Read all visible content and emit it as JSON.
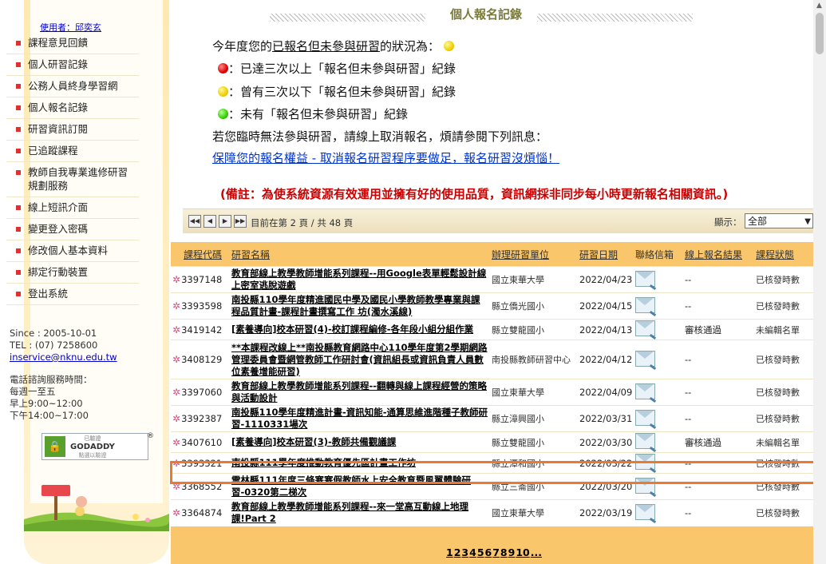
{
  "sidebar": {
    "user": "使用者：邱奕玄",
    "menu": [
      "課程意見回饋",
      "個人研習記錄",
      "公務人員終身學習網",
      "個人報名記錄",
      "研習資訊訂閱",
      "已追蹤課程",
      "教師自我專業進修研習規劃服務",
      "線上短訊介面",
      "變更登入密碼",
      "修改個人基本資料",
      "綁定行動裝置",
      "登出系統"
    ],
    "since": "Since : 2005-10-01",
    "tel": "TEL : (07) 7258600",
    "email": "inservice@nknu.edu.tw",
    "hours": [
      "電話諮詢服務時間：",
      "每週一至五",
      "早上9:00~12:00",
      "下午14:00~17:00"
    ],
    "badge": {
      "line1": "已驗證",
      "line2": "GODADDY",
      "line3": "點選以驗證"
    }
  },
  "page_title": "個人報名記錄",
  "status_info": {
    "intro_prefix": "今年度您的",
    "intro_underlined": "已報名但未參與研習",
    "intro_suffix": "的狀況為：",
    "red": "：已達三次以上「報名但未參與研習」紀錄",
    "yellow": "：曾有三次以下「報名但未參與研習」紀錄",
    "green": "：未有「報名但未參與研習」紀錄",
    "cancel_note": "若您臨時無法參與研習，請線上取消報名，煩請參閱下列訊息：",
    "link": "保障您的報名權益 - 取消報名研習程序要做足，報名研習沒煩惱！",
    "remark": "(備註：為使系統資源有效運用並擁有好的使用品質，資訊網採非同步每小時更新報名相關資訊。)"
  },
  "pager": {
    "text": "目前在第 2 頁 / 共 48 頁",
    "display_label": "顯示：",
    "display_value": "全部",
    "pages": [
      "1",
      "2",
      "3",
      "4",
      "5",
      "6",
      "7",
      "8",
      "9",
      "10",
      "..."
    ]
  },
  "table": {
    "headers": [
      "課程代碼",
      "研習名稱",
      "辦理研習單位",
      "研習日期",
      "聯絡信箱",
      "線上報名結果",
      "課程狀態"
    ],
    "rows": [
      {
        "code": "3397148",
        "name": "教育部線上教學教師增能系列課程--用Google表單輕鬆設計線上密室逃脫遊戲",
        "unit": "國立東華大學",
        "date": "2022/04/23",
        "result": "--",
        "status": "已核發時數"
      },
      {
        "code": "3393598",
        "name": "南投縣110學年度精進國民中學及國民小學教師教學專業與課程品質計畫-課程計畫撰寫工作 坊(濁水溪線)",
        "unit": "縣立僑光國小",
        "date": "2022/04/15",
        "result": "--",
        "status": "已核發時數"
      },
      {
        "code": "3419142",
        "name": "[素養導向]校本研習(4)-校訂課程編修-各年段小組分組作業",
        "unit": "縣立雙龍國小",
        "date": "2022/04/13",
        "result": "審核通過",
        "status": "未編輯名單"
      },
      {
        "code": "3408129",
        "name": "**本課程改線上**南投縣教育網路中心110學年度第2學期網路管理委員會暨網管教師工作研討會(資訊組長或資訊負責人員數位素養增能研習)",
        "unit": "南投縣教師研習中心",
        "date": "2022/04/12",
        "result": "--",
        "status": "已核發時數"
      },
      {
        "code": "3397060",
        "name": "教育部線上教學教師增能系列課程--翻轉與線上課程經營的策略與活動設計",
        "unit": "國立東華大學",
        "date": "2022/04/09",
        "result": "--",
        "status": "已核發時數"
      },
      {
        "code": "3392387",
        "name": "南投縣110學年度精進計畫-資訊知能-通算思維進階種子教師研習-1110331場次",
        "unit": "縣立漳興國小",
        "date": "2022/03/31",
        "result": "--",
        "status": "已核發時數"
      },
      {
        "code": "3407610",
        "name": "[素養導向]校本研習(3)-教師共備觀議課",
        "unit": "縣立雙龍國小",
        "date": "2022/03/30",
        "result": "審核通過",
        "status": "未編輯名單"
      },
      {
        "code": "3393321",
        "name": "南投縣111學年度推動教育優先區計畫工作坊",
        "unit": "縣立潭和國小",
        "date": "2022/03/22",
        "result": "--",
        "status": "已核發時數"
      },
      {
        "code": "3368552",
        "name": "雲林縣111年度三條寒寒假教師水上安全教育暨風翼體驗研習-0320第二梯次",
        "unit": "縣立三崙國小",
        "date": "2022/03/20",
        "result": "--",
        "status": "已核發時數"
      },
      {
        "code": "3364874",
        "name": "教育部線上教學教師增能系列課程--來一堂高互動線上地理課!Part 2",
        "unit": "國立東華大學",
        "date": "2022/03/19",
        "result": "--",
        "status": "已核發時數"
      }
    ]
  },
  "colors": {
    "accent": "#f9c66b",
    "highlight": "#ec7a2e",
    "link": "#0033cc",
    "remark": "#cc0000"
  }
}
